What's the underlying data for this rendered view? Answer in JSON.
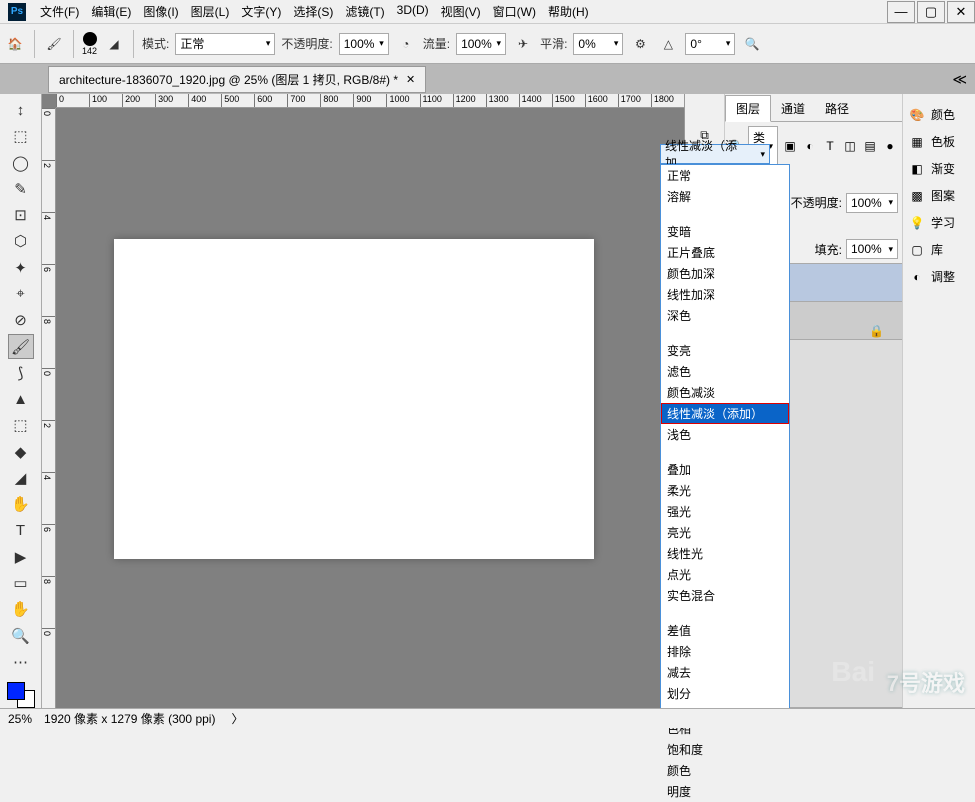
{
  "menu": [
    "文件(F)",
    "编辑(E)",
    "图像(I)",
    "图层(L)",
    "文字(Y)",
    "选择(S)",
    "滤镜(T)",
    "3D(D)",
    "视图(V)",
    "窗口(W)",
    "帮助(H)"
  ],
  "optbar": {
    "brush_size": "142",
    "mode_label": "模式:",
    "mode_value": "正常",
    "opacity_label": "不透明度:",
    "opacity_value": "100%",
    "flow_label": "流量:",
    "flow_value": "100%",
    "smooth_label": "平滑:",
    "smooth_value": "0%",
    "angle_value": "0°"
  },
  "tab": {
    "title": "architecture-1836070_1920.jpg @ 25% (图层 1 拷贝, RGB/8#) *"
  },
  "ruler_h": [
    "0",
    "100",
    "200",
    "300",
    "400",
    "500",
    "600",
    "700",
    "800",
    "900",
    "1000",
    "1100",
    "1200",
    "1300",
    "1400",
    "1500",
    "1600",
    "1700",
    "1800"
  ],
  "ruler_v": [
    "0",
    "2",
    "4",
    "6",
    "8",
    "0",
    "2",
    "4",
    "6",
    "8",
    "0"
  ],
  "panel_tabs": [
    "图层",
    "通道",
    "路径"
  ],
  "kind_label": "类型",
  "blend_selected": "线性减淡（添加…",
  "opacity_panel_label": "不透明度:",
  "opacity_panel_value": "100%",
  "fill_label": "填充:",
  "fill_value": "100%",
  "right_items": [
    {
      "icon": "🎨",
      "label": "颜色"
    },
    {
      "icon": "▦",
      "label": "色板"
    },
    {
      "icon": "◧",
      "label": "渐变"
    },
    {
      "icon": "▩",
      "label": "图案"
    },
    {
      "icon": "💡",
      "label": "学习"
    },
    {
      "icon": "▢",
      "label": "库"
    },
    {
      "icon": "◐",
      "label": "调整"
    }
  ],
  "blend_modes": [
    "正常",
    "溶解",
    "",
    "变暗",
    "正片叠底",
    "颜色加深",
    "线性加深",
    "深色",
    "",
    "变亮",
    "滤色",
    "颜色减淡",
    "线性减淡（添加）",
    "浅色",
    "",
    "叠加",
    "柔光",
    "强光",
    "亮光",
    "线性光",
    "点光",
    "实色混合",
    "",
    "差值",
    "排除",
    "减去",
    "划分",
    "",
    "色相",
    "饱和度",
    "颜色",
    "明度"
  ],
  "blend_selected_index": 12,
  "status": {
    "zoom": "25%",
    "dims": "1920 像素 x 1279 像素 (300 ppi)"
  },
  "tools": [
    "↕",
    "⬚",
    "◯",
    "✎",
    "⊡",
    "⬡",
    "✦",
    "⌖",
    "⊘",
    "🖌",
    "⟆",
    "▲",
    "⬚",
    "◆",
    "◢",
    "✋",
    "T",
    "▶",
    "▭",
    "✋",
    "🔍",
    "⋯"
  ],
  "watermark1": "7号游戏",
  "watermark2": "Bai"
}
